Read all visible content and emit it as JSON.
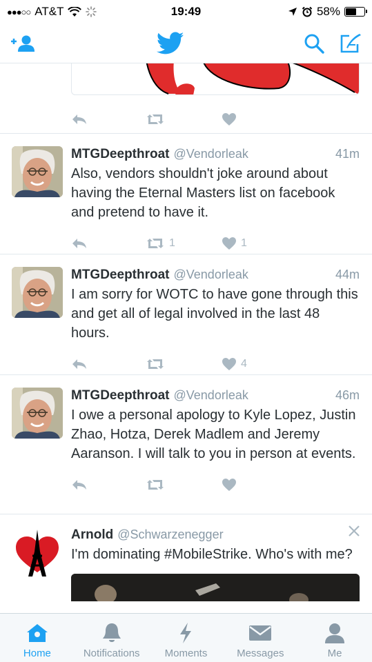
{
  "status_bar": {
    "signal": "●●●○○",
    "carrier": "AT&T",
    "time": "19:49",
    "battery_percent": "58%",
    "battery_level": 0.58
  },
  "nav": {
    "icons": [
      "add-user-icon",
      "twitter-bird-icon",
      "search-icon",
      "compose-icon"
    ],
    "accent_color": "#1da1f2"
  },
  "tweets": [
    {
      "name": "MTGDeepthroat",
      "handle": "@Vendorleak",
      "time": "41m",
      "text": "Also, vendors shouldn't joke around about having the Eternal Masters list on facebook and pretend to have it.",
      "retweets": "1",
      "likes": "1"
    },
    {
      "name": "MTGDeepthroat",
      "handle": "@Vendorleak",
      "time": "44m",
      "text": "I am sorry for WOTC to have gone through this and get all of legal involved in the last 48 hours.",
      "retweets": "",
      "likes": "4"
    },
    {
      "name": "MTGDeepthroat",
      "handle": "@Vendorleak",
      "time": "46m",
      "text": "I owe a personal apology to Kyle Lopez, Justin Zhao, Hotza, Derek Madlem and Jeremy Aaranson. I will talk to you in person at events.",
      "retweets": "",
      "likes": ""
    },
    {
      "name": "Arnold",
      "handle": "@Schwarzenegger",
      "time": "",
      "text": "I'm dominating #MobileStrike. Who's with me?"
    }
  ],
  "tabs": [
    {
      "label": "Home",
      "icon": "home-icon"
    },
    {
      "label": "Notifications",
      "icon": "bell-icon"
    },
    {
      "label": "Moments",
      "icon": "lightning-icon"
    },
    {
      "label": "Messages",
      "icon": "envelope-icon"
    },
    {
      "label": "Me",
      "icon": "person-icon"
    }
  ]
}
